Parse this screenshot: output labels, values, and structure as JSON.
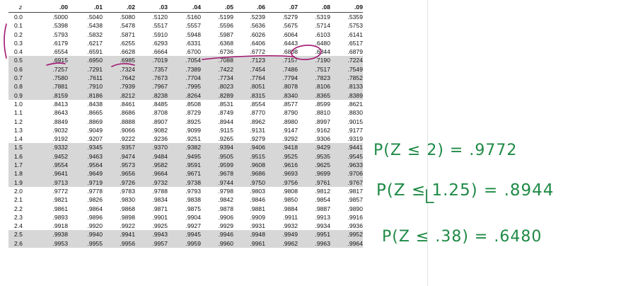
{
  "table": {
    "header_z": "z",
    "columns": [
      ".00",
      ".01",
      ".02",
      ".03",
      ".04",
      ".05",
      ".06",
      ".07",
      ".08",
      ".09"
    ],
    "rows": [
      {
        "z": "0.0",
        "values": [
          ".5000",
          ".5040",
          ".5080",
          ".5120",
          ".5160",
          ".5199",
          ".5239",
          ".5279",
          ".5319",
          ".5359"
        ]
      },
      {
        "z": "0.1",
        "values": [
          ".5398",
          ".5438",
          ".5478",
          ".5517",
          ".5557",
          ".5596",
          ".5636",
          ".5675",
          ".5714",
          ".5753"
        ]
      },
      {
        "z": "0.2",
        "values": [
          ".5793",
          ".5832",
          ".5871",
          ".5910",
          ".5948",
          ".5987",
          ".6026",
          ".6064",
          ".6103",
          ".6141"
        ]
      },
      {
        "z": "0.3",
        "values": [
          ".6179",
          ".6217",
          ".6255",
          ".6293",
          ".6331",
          ".6368",
          ".6406",
          ".6443",
          ".6480",
          ".6517"
        ]
      },
      {
        "z": "0.4",
        "values": [
          ".6554",
          ".6591",
          ".6628",
          ".6664",
          ".6700",
          ".6736",
          ".6772",
          ".6808",
          ".6844",
          ".6879"
        ]
      },
      {
        "z": "0.5",
        "values": [
          ".6915",
          ".6950",
          ".6985",
          ".7019",
          ".7054",
          ".7088",
          ".7123",
          ".7157",
          ".7190",
          ".7224"
        ]
      },
      {
        "z": "0.6",
        "values": [
          ".7257",
          ".7291",
          ".7324",
          ".7357",
          ".7389",
          ".7422",
          ".7454",
          ".7486",
          ".7517",
          ".7549"
        ]
      },
      {
        "z": "0.7",
        "values": [
          ".7580",
          ".7611",
          ".7642",
          ".7673",
          ".7704",
          ".7734",
          ".7764",
          ".7794",
          ".7823",
          ".7852"
        ]
      },
      {
        "z": "0.8",
        "values": [
          ".7881",
          ".7910",
          ".7939",
          ".7967",
          ".7995",
          ".8023",
          ".8051",
          ".8078",
          ".8106",
          ".8133"
        ]
      },
      {
        "z": "0.9",
        "values": [
          ".8159",
          ".8186",
          ".8212",
          ".8238",
          ".8264",
          ".8289",
          ".8315",
          ".8340",
          ".8365",
          ".8389"
        ]
      },
      {
        "z": "1.0",
        "values": [
          ".8413",
          ".8438",
          ".8461",
          ".8485",
          ".8508",
          ".8531",
          ".8554",
          ".8577",
          ".8599",
          ".8621"
        ]
      },
      {
        "z": "1.1",
        "values": [
          ".8643",
          ".8665",
          ".8686",
          ".8708",
          ".8729",
          ".8749",
          ".8770",
          ".8790",
          ".8810",
          ".8830"
        ]
      },
      {
        "z": "1.2",
        "values": [
          ".8849",
          ".8869",
          ".8888",
          ".8907",
          ".8925",
          ".8944",
          ".8962",
          ".8980",
          ".8997",
          ".9015"
        ]
      },
      {
        "z": "1.3",
        "values": [
          ".9032",
          ".9049",
          ".9066",
          ".9082",
          ".9099",
          ".9115",
          ".9131",
          ".9147",
          ".9162",
          ".9177"
        ]
      },
      {
        "z": "1.4",
        "values": [
          ".9192",
          ".9207",
          ".9222",
          ".9236",
          ".9251",
          ".9265",
          ".9279",
          ".9292",
          ".9306",
          ".9319"
        ]
      },
      {
        "z": "1.5",
        "values": [
          ".9332",
          ".9345",
          ".9357",
          ".9370",
          ".9382",
          ".9394",
          ".9406",
          ".9418",
          ".9429",
          ".9441"
        ]
      },
      {
        "z": "1.6",
        "values": [
          ".9452",
          ".9463",
          ".9474",
          ".9484",
          ".9495",
          ".9505",
          ".9515",
          ".9525",
          ".9535",
          ".9545"
        ]
      },
      {
        "z": "1.7",
        "values": [
          ".9554",
          ".9564",
          ".9573",
          ".9582",
          ".9591",
          ".9599",
          ".9608",
          ".9616",
          ".9625",
          ".9633"
        ]
      },
      {
        "z": "1.8",
        "values": [
          ".9641",
          ".9649",
          ".9656",
          ".9664",
          ".9671",
          ".9678",
          ".9686",
          ".9693",
          ".9699",
          ".9706"
        ]
      },
      {
        "z": "1.9",
        "values": [
          ".9713",
          ".9719",
          ".9726",
          ".9732",
          ".9738",
          ".9744",
          ".9750",
          ".9756",
          ".9761",
          ".9767"
        ]
      },
      {
        "z": "2.0",
        "values": [
          ".9772",
          ".9778",
          ".9783",
          ".9788",
          ".9793",
          ".9798",
          ".9803",
          ".9808",
          ".9812",
          ".9817"
        ]
      },
      {
        "z": "2.1",
        "values": [
          ".9821",
          ".9826",
          ".9830",
          ".9834",
          ".9838",
          ".9842",
          ".9846",
          ".9850",
          ".9854",
          ".9857"
        ]
      },
      {
        "z": "2.2",
        "values": [
          ".9861",
          ".9864",
          ".9868",
          ".9871",
          ".9875",
          ".9878",
          ".9881",
          ".9884",
          ".9887",
          ".9890"
        ]
      },
      {
        "z": "2.3",
        "values": [
          ".9893",
          ".9896",
          ".9898",
          ".9901",
          ".9904",
          ".9906",
          ".9909",
          ".9911",
          ".9913",
          ".9916"
        ]
      },
      {
        "z": "2.4",
        "values": [
          ".9918",
          ".9920",
          ".9922",
          ".9925",
          ".9927",
          ".9929",
          ".9931",
          ".9932",
          ".9934",
          ".9936"
        ]
      },
      {
        "z": "2.5",
        "values": [
          ".9938",
          ".9940",
          ".9941",
          ".9943",
          ".9945",
          ".9946",
          ".9948",
          ".9949",
          ".9951",
          ".9952"
        ]
      },
      {
        "z": "2.6",
        "values": [
          ".9953",
          ".9955",
          ".9956",
          ".9957",
          ".9959",
          ".9960",
          ".9961",
          ".9962",
          ".9963",
          ".9964"
        ]
      }
    ]
  },
  "notes": {
    "line1": "P(Z ≤ 2) = .9772",
    "line2": "P(Z ≤ 1.25) = .8944",
    "line3": "P(Z ≤ .38) = .6480"
  },
  "colors": {
    "notes_ink": "#1f8a46",
    "annotation_ink": "#a0156f",
    "shade": "#d7d7d7"
  }
}
